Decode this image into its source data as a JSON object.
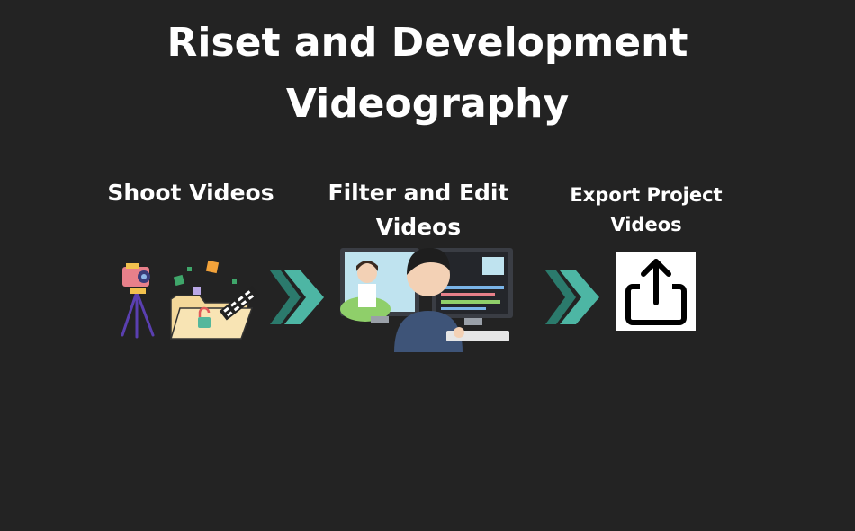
{
  "title": {
    "line1": "Riset and Development",
    "line2": "Videography"
  },
  "steps": [
    {
      "label_line1": "Shoot Videos",
      "label_line2": "",
      "icon": "camera-folder-icon"
    },
    {
      "label_line1": "Filter and Edit",
      "label_line2": "Videos",
      "icon": "video-editing-icon"
    },
    {
      "label_line1": "Export Project",
      "label_line2": "Videos",
      "icon": "share-export-icon"
    }
  ],
  "colors": {
    "background": "#232323",
    "text": "#ffffff",
    "arrow_fill": "#4db6a4",
    "arrow_dark": "#2b7a6c"
  }
}
